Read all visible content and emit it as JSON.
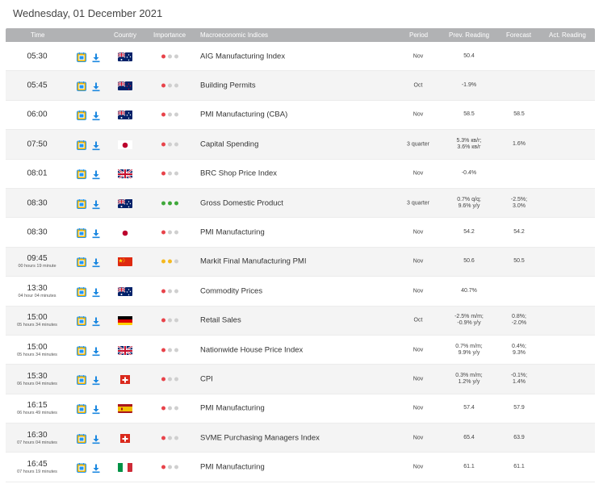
{
  "date": "Wednesday, 01 December 2021",
  "columns": {
    "time": "Time",
    "country": "Country",
    "importance": "Importance",
    "indices": "Macroeconomic Indices",
    "period": "Period",
    "prev": "Prev. Reading",
    "forecast": "Forecast",
    "actual": "Act. Reading"
  },
  "colors": {
    "importance_high": "#e8434a",
    "importance_medium": "#f5b920",
    "importance_low_dot": "#cfcfcf",
    "importance_green": "#3fa83a",
    "calendar_icon": "#2196f3",
    "download_icon": "#1a87e0"
  },
  "rows": [
    {
      "time": "05:30",
      "note": "",
      "flag": "au",
      "importance": [
        "red",
        "grey",
        "grey"
      ],
      "indicator": "AIG Manufacturing Index",
      "period": "Nov",
      "prev": [
        "50.4"
      ],
      "forecast": [],
      "actual": ""
    },
    {
      "time": "05:45",
      "note": "",
      "flag": "nz",
      "importance": [
        "red",
        "grey",
        "grey"
      ],
      "indicator": "Building Permits",
      "period": "Oct",
      "prev": [
        "-1.9%"
      ],
      "forecast": [],
      "actual": ""
    },
    {
      "time": "06:00",
      "note": "",
      "flag": "au",
      "importance": [
        "red",
        "grey",
        "grey"
      ],
      "indicator": "PMI Manufacturing (CBA)",
      "period": "Nov",
      "prev": [
        "58.5"
      ],
      "forecast": [
        "58.5"
      ],
      "actual": ""
    },
    {
      "time": "07:50",
      "note": "",
      "flag": "jp",
      "importance": [
        "red",
        "grey",
        "grey"
      ],
      "indicator": "Capital Spending",
      "period": "3 quarter",
      "prev": [
        "5.3% кв/г;",
        "3.6% кв/г"
      ],
      "forecast": [
        "1.6%"
      ],
      "actual": ""
    },
    {
      "time": "08:01",
      "note": "",
      "flag": "gb",
      "importance": [
        "red",
        "grey",
        "grey"
      ],
      "indicator": "BRC Shop Price Index",
      "period": "Nov",
      "prev": [
        "-0.4%"
      ],
      "forecast": [],
      "actual": ""
    },
    {
      "time": "08:30",
      "note": "",
      "flag": "au",
      "importance": [
        "green",
        "green",
        "green"
      ],
      "indicator": "Gross Domestic Product",
      "period": "3 quarter",
      "prev": [
        "0.7% q/q;",
        "9.6% y/y"
      ],
      "forecast": [
        "-2.5%;",
        "3.0%"
      ],
      "actual": ""
    },
    {
      "time": "08:30",
      "note": "",
      "flag": "jp",
      "importance": [
        "red",
        "grey",
        "grey"
      ],
      "indicator": "PMI Manufacturing",
      "period": "Nov",
      "prev": [
        "54.2"
      ],
      "forecast": [
        "54.2"
      ],
      "actual": ""
    },
    {
      "time": "09:45",
      "note": "00 hours 19 minute",
      "flag": "cn",
      "importance": [
        "yellow",
        "yellow",
        "grey"
      ],
      "indicator": "Markit Final Manufacturing PMI",
      "period": "Nov",
      "prev": [
        "50.6"
      ],
      "forecast": [
        "50.5"
      ],
      "actual": ""
    },
    {
      "time": "13:30",
      "note": "04 hour 04 minutes",
      "flag": "au",
      "importance": [
        "red",
        "grey",
        "grey"
      ],
      "indicator": "Commodity Prices",
      "period": "Nov",
      "prev": [
        "40.7%"
      ],
      "forecast": [],
      "actual": ""
    },
    {
      "time": "15:00",
      "note": "05 hours 34 minutes",
      "flag": "de",
      "importance": [
        "red",
        "grey",
        "grey"
      ],
      "indicator": "Retail Sales",
      "period": "Oct",
      "prev": [
        "-2.5% m/m;",
        "-0.9% y/y"
      ],
      "forecast": [
        "0.8%;",
        "-2.0%"
      ],
      "actual": ""
    },
    {
      "time": "15:00",
      "note": "05 hours 34 minutes",
      "flag": "gb",
      "importance": [
        "red",
        "grey",
        "grey"
      ],
      "indicator": "Nationwide House Price Index",
      "period": "Nov",
      "prev": [
        "0.7% m/m;",
        "9.9% y/y"
      ],
      "forecast": [
        "0.4%;",
        "9.3%"
      ],
      "actual": ""
    },
    {
      "time": "15:30",
      "note": "06 hours 04 minutes",
      "flag": "ch",
      "importance": [
        "red",
        "grey",
        "grey"
      ],
      "indicator": "CPI",
      "period": "Nov",
      "prev": [
        "0.3% m/m;",
        "1.2% y/y"
      ],
      "forecast": [
        "-0.1%;",
        "1.4%"
      ],
      "actual": ""
    },
    {
      "time": "16:15",
      "note": "06 hours 49 minutes",
      "flag": "es",
      "importance": [
        "red",
        "grey",
        "grey"
      ],
      "indicator": "PMI Manufacturing",
      "period": "Nov",
      "prev": [
        "57.4"
      ],
      "forecast": [
        "57.9"
      ],
      "actual": ""
    },
    {
      "time": "16:30",
      "note": "07 hours 04 minutes",
      "flag": "ch",
      "importance": [
        "red",
        "grey",
        "grey"
      ],
      "indicator": "SVME Purchasing Managers Index",
      "period": "Nov",
      "prev": [
        "65.4"
      ],
      "forecast": [
        "63.9"
      ],
      "actual": ""
    },
    {
      "time": "16:45",
      "note": "07 hours 19 minutes",
      "flag": "it",
      "importance": [
        "red",
        "grey",
        "grey"
      ],
      "indicator": "PMI Manufacturing",
      "period": "Nov",
      "prev": [
        "61.1"
      ],
      "forecast": [
        "61.1"
      ],
      "actual": ""
    }
  ]
}
